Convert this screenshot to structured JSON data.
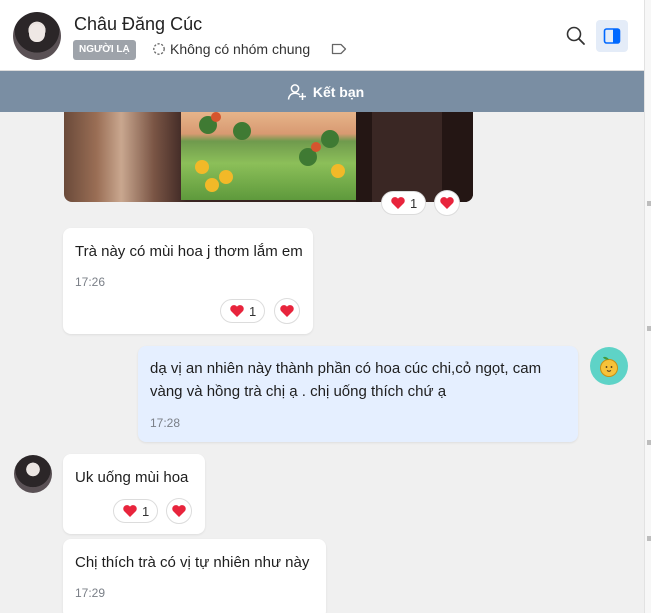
{
  "header": {
    "contact_name": "Châu Đăng Cúc",
    "stranger_badge": "NGƯỜI LẠ",
    "mutual_groups": "Không có nhóm chung"
  },
  "friend_bar": {
    "add_friend_label": "Kết bạn"
  },
  "messages": [
    {
      "id": "m0",
      "type": "image",
      "reaction_count": "1"
    },
    {
      "id": "m1",
      "sender": "contact",
      "text": "Trà này có mùi hoa j thơm lắm em",
      "time": "17:26",
      "reaction_count": "1"
    },
    {
      "id": "m2",
      "sender": "me",
      "text_line1": "dạ vị an nhiên này thành phần có hoa cúc chi,cỏ ngọt, cam",
      "text_line2": "vàng và hồng trà chị ạ . chị uống thích chứ ạ",
      "time": "17:28"
    },
    {
      "id": "m3",
      "sender": "contact",
      "text": "Uk uống mùi hoa",
      "reaction_count": "1"
    },
    {
      "id": "m4",
      "sender": "contact",
      "text": "Chị thích trà có vị tự nhiên như này",
      "time": "17:29"
    }
  ],
  "colors": {
    "friend_bar_bg": "#7a8ea3",
    "my_bubble_bg": "#e5efff",
    "heart": "#e8243c",
    "accent_blue": "#0068ff"
  }
}
